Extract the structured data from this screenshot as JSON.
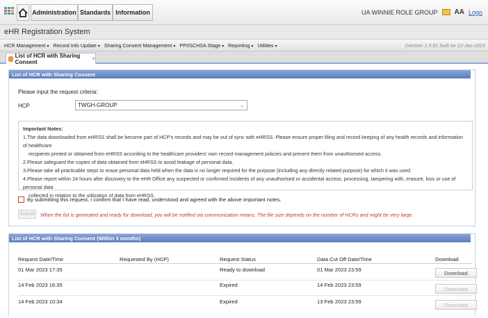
{
  "topbar": {
    "tabs": [
      "Administration",
      "Standards",
      "Information"
    ],
    "user_group": "UA WINNIE ROLE GROUP",
    "font_size_label": "AA",
    "logout_label": "Logo"
  },
  "system_title": "eHR Registration System",
  "menu": {
    "items": [
      "HCR Management",
      "Record Info Update",
      "Sharing Consent Management",
      "PPI/SCHSA Stage",
      "Reporting",
      "Utilities"
    ],
    "version": "(version 1.5.81 built on 12-Jan-2023"
  },
  "page_tab": {
    "label": "List of HCR with Sharing Consent",
    "close": "×"
  },
  "criteria_panel": {
    "title": "List of HCR with Sharing Consent",
    "prompt": "Please input the request criteria:",
    "hcp_label": "HCP",
    "hcp_value": "TWGH-GROUP",
    "notes_title": "Important Notes:",
    "notes": [
      "1.The data downloaded from eHRSS shall be become part of HCP's records and may be out of sync with eHRSS. Please ensure proper filing and record keeping of any health records and information of healthcare",
      "recipients printed or obtained from eHRSS according to the healthcare providers' own record management policies and prevent them from unauthorised access.",
      "2.Please safeguard the copies of data obtained from eHRSS to avoid leakage of personal data.",
      "3.Please take all practicable steps to erase personal data held when the data is no longer required for the purpose (including any directly related purpose) for which it was used.",
      "4.Please report within 24 hours after discovery to the eHR Office any suspected or confirmed incidents of any unauthorised or accidental access, processing, tampering with, erasure, loss or use of personal data",
      "collected in relation to the utilization of data from eHRSS."
    ],
    "confirm_text": "By submitting this request, I confirm that I have read, understood and agreed with the above important notes.",
    "submit_label": "Submit",
    "warning": "When the list is generated and ready for download, you will be notified via communication means. The file size depends on the number of HCRs and might be very large."
  },
  "list_panel": {
    "title": "List of HCR with Sharing Consent (Within 3 months)",
    "columns": [
      "Request Date/Time",
      "Requested By (HCP)",
      "Request Status",
      "Data Cut Off Date/Time",
      "Download"
    ],
    "rows": [
      {
        "request": "01 Mar 2023 17:35",
        "by": "",
        "status": "Ready to download",
        "cutoff": "01 Mar 2023 23:59",
        "download": "Download"
      },
      {
        "request": "14 Feb 2023 16:35",
        "by": "",
        "status": "Expired",
        "cutoff": "14 Feb 2023 23:59",
        "download": "Download"
      },
      {
        "request": "14 Feb 2023 10:34",
        "by": "",
        "status": "Expired",
        "cutoff": "13 Feb 2023 23:59",
        "download": "Download"
      }
    ]
  },
  "colors": {
    "panel_header": "#5b7cc0",
    "warning": "#c0392b",
    "accent_tab": "#8aa8d8"
  }
}
